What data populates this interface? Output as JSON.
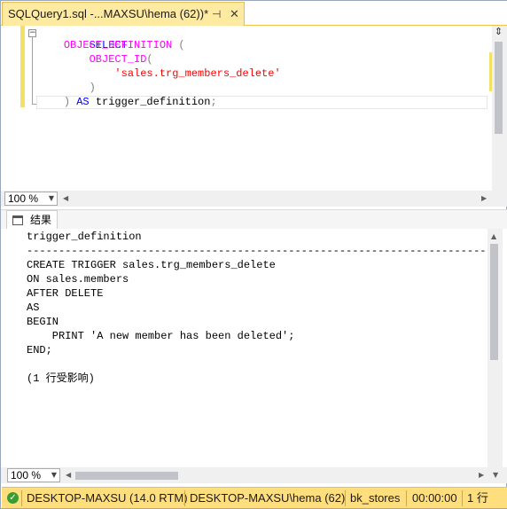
{
  "tab": {
    "title": "SQLQuery1.sql -...MAXSU\\hema (62))*",
    "pin_glyph": "⊣",
    "close_glyph": "✕"
  },
  "editor": {
    "lines": [
      {
        "t1": "SELECT"
      },
      {
        "indent": "    ",
        "t1": "OBJECT_DEFINITION",
        "t2": " ("
      },
      {
        "indent": "        ",
        "t1": "OBJECT_ID",
        "t2": "("
      },
      {
        "indent": "            ",
        "t1": "'sales.trg_members_delete'"
      },
      {
        "indent": "        ",
        "t1": ")"
      },
      {
        "indent": "    ",
        "t1": ")",
        "t2": " AS",
        "t3": " trigger_definition",
        "t4": ";"
      }
    ],
    "zoom": "100 %"
  },
  "results_tab": {
    "label": "结果"
  },
  "results": {
    "lines": [
      "trigger_definition",
      "------------------------------------------------------------------------",
      "CREATE TRIGGER sales.trg_members_delete",
      "ON sales.members",
      "AFTER DELETE",
      "AS",
      "BEGIN",
      "    PRINT 'A new member has been deleted';",
      "END;",
      "",
      "(1 行受影响)"
    ],
    "zoom": "100 %"
  },
  "statusbar": {
    "server": "DESKTOP-MAXSU (14.0 RTM)",
    "user": "DESKTOP-MAXSU\\hema (62)",
    "database": "bk_stores",
    "elapsed": "00:00:00",
    "rows": "1 行"
  },
  "colors": {
    "tab_active": "#ffeaa1",
    "statusbar": "#ffde7d",
    "keyword": "#0000ff",
    "function": "#ff00ff",
    "string": "#ff0000"
  }
}
